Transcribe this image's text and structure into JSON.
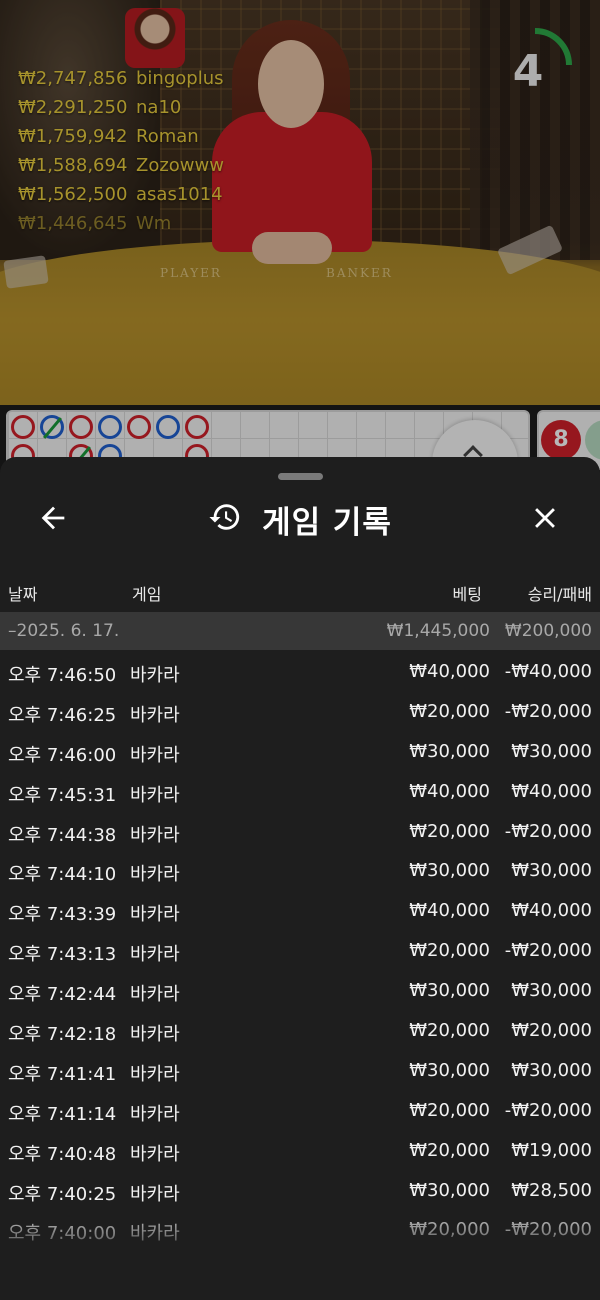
{
  "leaderboard": [
    {
      "amount": "₩2,747,856",
      "name": "bingoplus"
    },
    {
      "amount": "₩2,291,250",
      "name": "na10"
    },
    {
      "amount": "₩1,759,942",
      "name": "Roman"
    },
    {
      "amount": "₩1,588,694",
      "name": "Zozowww"
    },
    {
      "amount": "₩1,562,500",
      "name": "asas1014"
    },
    {
      "amount": "₩1,446,645",
      "name": "Wm"
    }
  ],
  "table_labels": {
    "player": "PLAYER",
    "banker": "BANKER"
  },
  "timer": {
    "value": "4",
    "progress": 0.25,
    "color": "#2fa84a"
  },
  "side_stats": {
    "badge": "8"
  },
  "sheet": {
    "title": "게임 기록",
    "icons": {
      "back": "arrow-left-icon",
      "history": "history-icon",
      "close": "close-icon"
    }
  },
  "columns": {
    "date": "날짜",
    "game": "게임",
    "bet": "베팅",
    "result": "승리/패배"
  },
  "date_group": {
    "date": "–2025. 6. 17.",
    "bet_total": "₩1,445,000",
    "result_total": "₩200,000"
  },
  "history": [
    {
      "time": "오후 7:46:50",
      "game": "바카라",
      "bet": "₩40,000",
      "result": "-₩40,000"
    },
    {
      "time": "오후 7:46:25",
      "game": "바카라",
      "bet": "₩20,000",
      "result": "-₩20,000"
    },
    {
      "time": "오후 7:46:00",
      "game": "바카라",
      "bet": "₩30,000",
      "result": "₩30,000"
    },
    {
      "time": "오후 7:45:31",
      "game": "바카라",
      "bet": "₩40,000",
      "result": "₩40,000"
    },
    {
      "time": "오후 7:44:38",
      "game": "바카라",
      "bet": "₩20,000",
      "result": "-₩20,000"
    },
    {
      "time": "오후 7:44:10",
      "game": "바카라",
      "bet": "₩30,000",
      "result": "₩30,000"
    },
    {
      "time": "오후 7:43:39",
      "game": "바카라",
      "bet": "₩40,000",
      "result": "₩40,000"
    },
    {
      "time": "오후 7:43:13",
      "game": "바카라",
      "bet": "₩20,000",
      "result": "-₩20,000"
    },
    {
      "time": "오후 7:42:44",
      "game": "바카라",
      "bet": "₩30,000",
      "result": "₩30,000"
    },
    {
      "time": "오후 7:42:18",
      "game": "바카라",
      "bet": "₩20,000",
      "result": "₩20,000"
    },
    {
      "time": "오후 7:41:41",
      "game": "바카라",
      "bet": "₩30,000",
      "result": "₩30,000"
    },
    {
      "time": "오후 7:41:14",
      "game": "바카라",
      "bet": "₩20,000",
      "result": "-₩20,000"
    },
    {
      "time": "오후 7:40:48",
      "game": "바카라",
      "bet": "₩20,000",
      "result": "₩19,000"
    },
    {
      "time": "오후 7:40:25",
      "game": "바카라",
      "bet": "₩30,000",
      "result": "₩28,500"
    },
    {
      "time": "오후 7:40:00",
      "game": "바카라",
      "bet": "₩20,000",
      "result": "-₩20,000"
    }
  ]
}
